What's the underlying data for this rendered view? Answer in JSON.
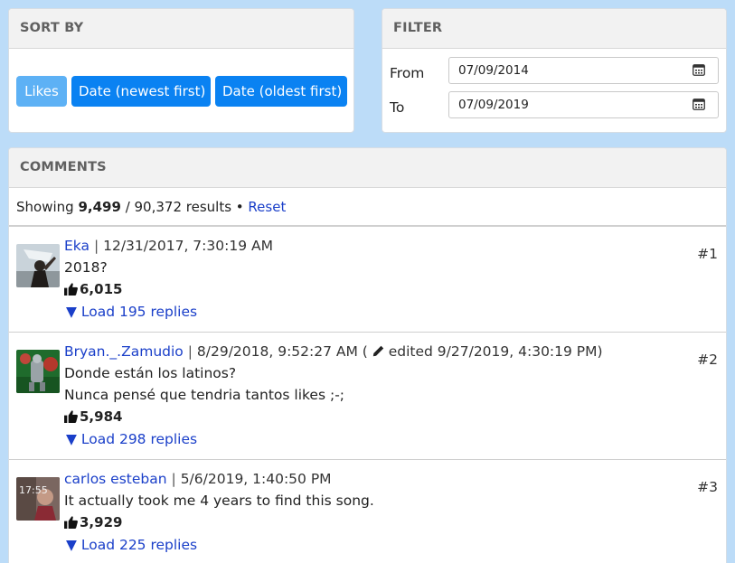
{
  "sort": {
    "header": "SORT BY",
    "buttons": [
      {
        "label": "Likes",
        "active": true
      },
      {
        "label": "Date (newest first)",
        "active": false
      },
      {
        "label": "Date (oldest first)",
        "active": false
      }
    ]
  },
  "filter": {
    "header": "FILTER",
    "from_label": "From",
    "to_label": "To",
    "from_value": "07/09/2014",
    "to_value": "07/09/2019",
    "icon": "calendar-icon"
  },
  "comments": {
    "header": "COMMENTS",
    "results": {
      "prefix": "Showing",
      "shown": "9,499",
      "total_text": "/ 90,372 results •",
      "reset": "Reset"
    },
    "items": [
      {
        "author": "Eka",
        "date": "12/31/2017, 7:30:19 AM",
        "number": "#1",
        "text": [
          "2018?"
        ],
        "likes": "6,015",
        "replies": "▼ Load 195 replies"
      },
      {
        "author": "Bryan._.Zamudio",
        "date": "8/29/2018, 9:52:27 AM (",
        "edited": "edited 9/27/2019, 4:30:19 PM)",
        "number": "#2",
        "text": [
          "Donde están los latinos?",
          "Nunca pensé que tendria tantos likes ;-;"
        ],
        "likes": "5,984",
        "replies": "▼ Load 298 replies"
      },
      {
        "author": "carlos esteban",
        "date": "5/6/2019, 1:40:50 PM",
        "number": "#3",
        "text": [
          "It actually took me 4 years to find this song."
        ],
        "likes": "3,929",
        "replies": "▼ Load 225 replies",
        "avatar_text": "17:55"
      }
    ]
  },
  "colors": {
    "page_bg": "#bcdcf8",
    "button": "#0a82f2",
    "button_active": "#5db1f5",
    "link": "#1a3fc9"
  }
}
